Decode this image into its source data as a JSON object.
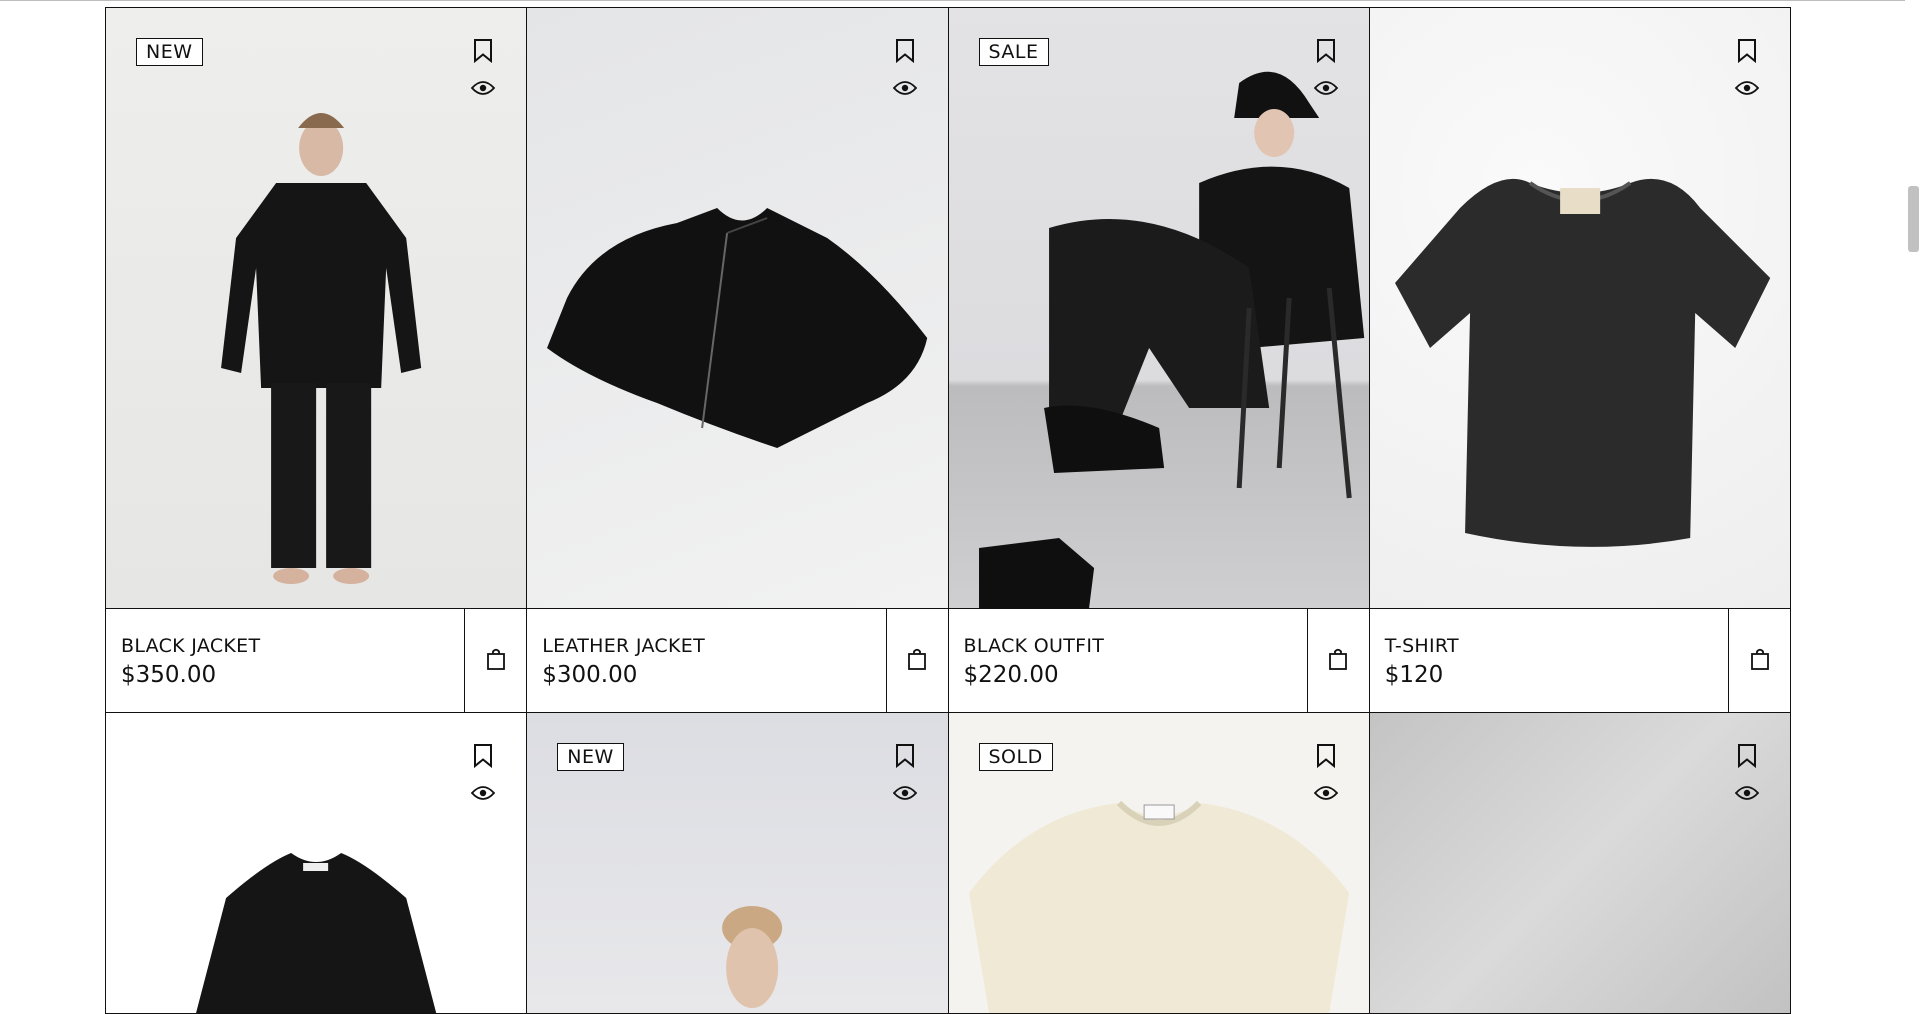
{
  "products": [
    {
      "badge": "NEW",
      "name": "BLACK JACKET",
      "price": "$350.00"
    },
    {
      "badge": "",
      "name": "LEATHER JACKET",
      "price": "$300.00"
    },
    {
      "badge": "SALE",
      "name": "BLACK OUTFIT",
      "price": "$220.00"
    },
    {
      "badge": "",
      "name": "T-SHIRT",
      "price": "$120"
    },
    {
      "badge": ""
    },
    {
      "badge": "NEW"
    },
    {
      "badge": "SOLD"
    },
    {
      "badge": ""
    }
  ],
  "icons": {
    "bookmark": "bookmark-icon",
    "quick_view": "eye-icon",
    "add_to_cart": "shopping-bag-icon"
  }
}
